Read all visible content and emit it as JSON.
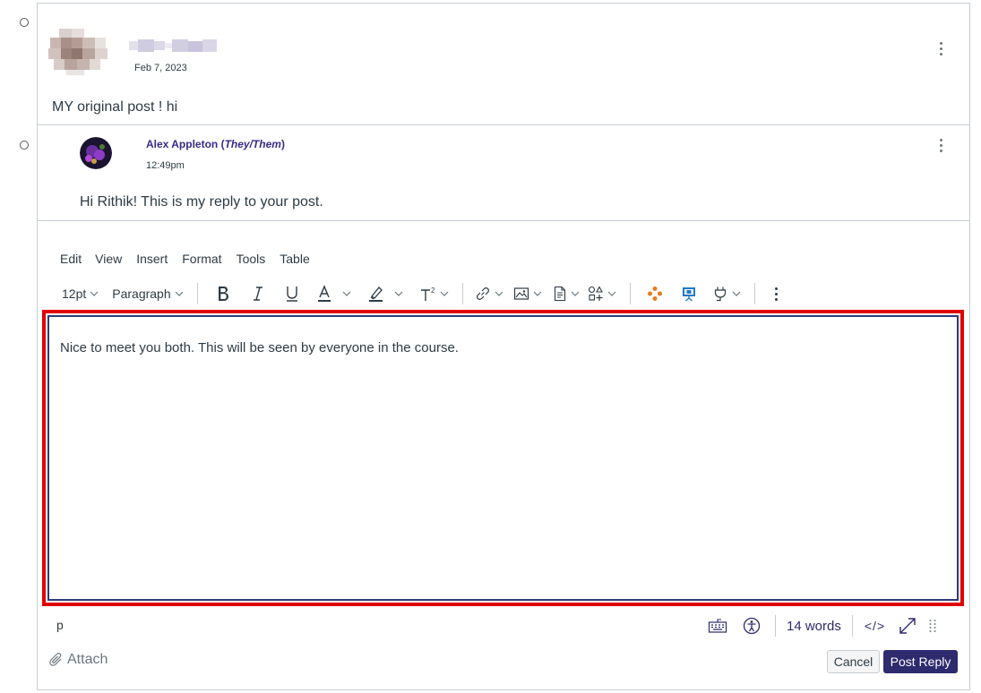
{
  "colors": {
    "accent": "#2d2a6e",
    "highlight_border": "#e10000",
    "author_name": "#3b2a8a",
    "border": "#c7cdd1",
    "text": "#2d3b45"
  },
  "post": {
    "date": "Feb 7, 2023",
    "body": "MY original post ! hi"
  },
  "reply": {
    "author": "Alex Appleton",
    "pronouns": "They/Them",
    "time": "12:49pm",
    "body": "Hi Rithik! This is my reply to your post."
  },
  "editor": {
    "menu": [
      "Edit",
      "View",
      "Insert",
      "Format",
      "Tools",
      "Table"
    ],
    "font_size": "12pt",
    "block_format": "Paragraph",
    "content": "Nice to meet you both. This will be seen by everyone in the course.",
    "path": "p",
    "word_count": "14 words",
    "html_toggle": "</>"
  },
  "actions": {
    "attach": "Attach",
    "cancel": "Cancel",
    "post_reply": "Post Reply"
  }
}
